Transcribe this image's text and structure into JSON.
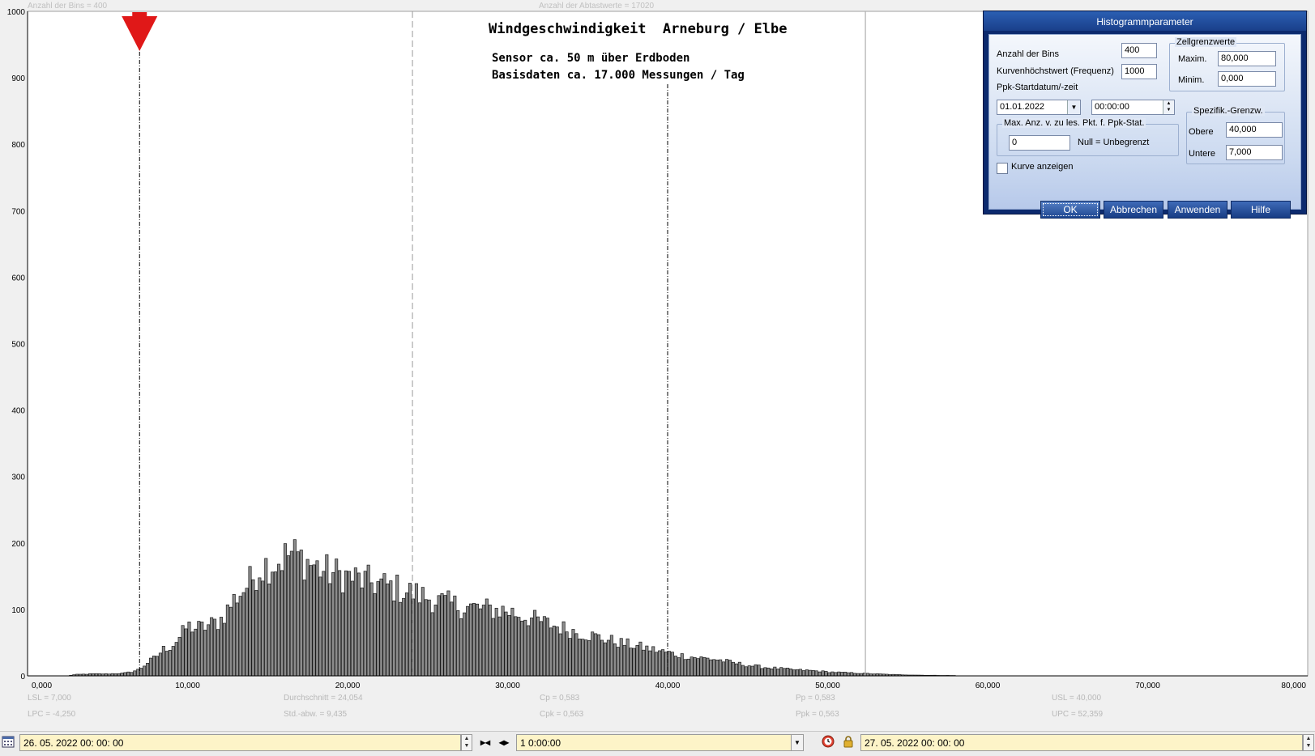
{
  "header": {
    "bins_label": "Anzahl der Bins =   400",
    "samples_label": "Anzahl der Abtastwerte = 17020"
  },
  "title": {
    "main": "Windgeschwindigkeit  Arneburg / Elbe",
    "line1": "Sensor ca. 50 m über Erdboden",
    "line2": "Basisdaten ca. 17.000 Messungen / Tag"
  },
  "stats": {
    "lsl": "LSL = 7,000",
    "lpc": "LPC = -4,250",
    "mean": "Durchschnitt  = 24,054",
    "std": "Std.-abw. = 9,435",
    "cp": "Cp  = 0,583",
    "cpk": "Cpk = 0,563",
    "pp": "Pp  = 0,583",
    "ppk": "Ppk = 0,563",
    "usl": "USL = 40,000",
    "upc": "UPC = 52,359"
  },
  "colors": {
    "bar_fill": "#8c8c8c",
    "marker": "#e01818",
    "axis": "#000000",
    "dialog_title": "#1a3f8a",
    "date_field": "#fdf4c8"
  },
  "chart_data": {
    "type": "bar",
    "title": "Windgeschwindigkeit  Arneburg / Elbe",
    "xlim": [
      0,
      80
    ],
    "ylim": [
      0,
      1000
    ],
    "xticks": [
      "0,000",
      "10,000",
      "20,000",
      "30,000",
      "40,000",
      "50,000",
      "60,000",
      "70,000",
      "80,000"
    ],
    "yticks": [
      "0",
      "100",
      "200",
      "300",
      "400",
      "500",
      "600",
      "700",
      "800",
      "900",
      "1000"
    ],
    "bin_width": 0.2,
    "lsl": 7.0,
    "usl": 40.0,
    "mean": 24.054,
    "lpc": -4.25,
    "upc": 52.359,
    "profile": [
      [
        2.5,
        0
      ],
      [
        3,
        2
      ],
      [
        4,
        3
      ],
      [
        5,
        3
      ],
      [
        6,
        4
      ],
      [
        6.5,
        6
      ],
      [
        7,
        10
      ],
      [
        7.5,
        20
      ],
      [
        8,
        28
      ],
      [
        8.5,
        40
      ],
      [
        9,
        45
      ],
      [
        9.5,
        58
      ],
      [
        10,
        75
      ],
      [
        10.5,
        72
      ],
      [
        11,
        73
      ],
      [
        11.5,
        78
      ],
      [
        12,
        82
      ],
      [
        12.5,
        100
      ],
      [
        13,
        118
      ],
      [
        13.5,
        130
      ],
      [
        14,
        145
      ],
      [
        14.5,
        162
      ],
      [
        15,
        168
      ],
      [
        15.5,
        170
      ],
      [
        16,
        178
      ],
      [
        16.5,
        185
      ],
      [
        17,
        178
      ],
      [
        17.5,
        172
      ],
      [
        18,
        165
      ],
      [
        18.5,
        158
      ],
      [
        19,
        155
      ],
      [
        20,
        150
      ],
      [
        21,
        143
      ],
      [
        22,
        138
      ],
      [
        23,
        132
      ],
      [
        24,
        125
      ],
      [
        25,
        118
      ],
      [
        26,
        110
      ],
      [
        27,
        105
      ],
      [
        28,
        102
      ],
      [
        29,
        100
      ],
      [
        30,
        98
      ],
      [
        31,
        90
      ],
      [
        32,
        82
      ],
      [
        33,
        75
      ],
      [
        34,
        68
      ],
      [
        35,
        62
      ],
      [
        36,
        56
      ],
      [
        37,
        50
      ],
      [
        38,
        45
      ],
      [
        39,
        40
      ],
      [
        40,
        35
      ],
      [
        41,
        30
      ],
      [
        42,
        27
      ],
      [
        43,
        25
      ],
      [
        44,
        20
      ],
      [
        45,
        16
      ],
      [
        46,
        13
      ],
      [
        47,
        11
      ],
      [
        48,
        9
      ],
      [
        49,
        8
      ],
      [
        50,
        6
      ],
      [
        51,
        5
      ],
      [
        52,
        4
      ],
      [
        53,
        3
      ],
      [
        54,
        2
      ],
      [
        56,
        1
      ],
      [
        58,
        0.5
      ],
      [
        60,
        0
      ],
      [
        80,
        0
      ]
    ]
  },
  "dialog": {
    "title": "Histogrammparameter",
    "bins_label": "Anzahl der Bins",
    "bins_value": "400",
    "freq_label": "Kurvenhöchstwert (Frequenz)",
    "freq_value": "1000",
    "start_label": "Ppk-Startdatum/-zeit",
    "start_date": "01.01.2022",
    "start_time": "00:00:00",
    "zell_title": "Zellgrenzwerte",
    "max_label": "Maxim.",
    "max_value": "80,000",
    "min_label": "Minim.",
    "min_value": "0,000",
    "spec_title": "Spezifik.-Grenzw.",
    "upper_label": "Obere",
    "upper_value": "40,000",
    "lower_label": "Untere",
    "lower_value": "7,000",
    "maxanz_title": "Max. Anz. v. zu les. Pkt. f. Ppk-Stat.",
    "maxanz_value": "0",
    "null_label": "Null = Unbegrenzt",
    "show_curve_label": "Kurve anzeigen",
    "ok": "OK",
    "cancel": "Abbrechen",
    "apply": "Anwenden",
    "help": "Hilfe"
  },
  "bottom": {
    "start": "26. 05. 2022   00: 00: 00",
    "interval": "1 0:00:00",
    "end": "27. 05. 2022   00: 00: 00"
  },
  "icons": {
    "calendar": "calendar-icon",
    "compress": "compress-icon",
    "expand": "expand-icon",
    "clock": "clock-icon",
    "lock": "lock-icon"
  }
}
